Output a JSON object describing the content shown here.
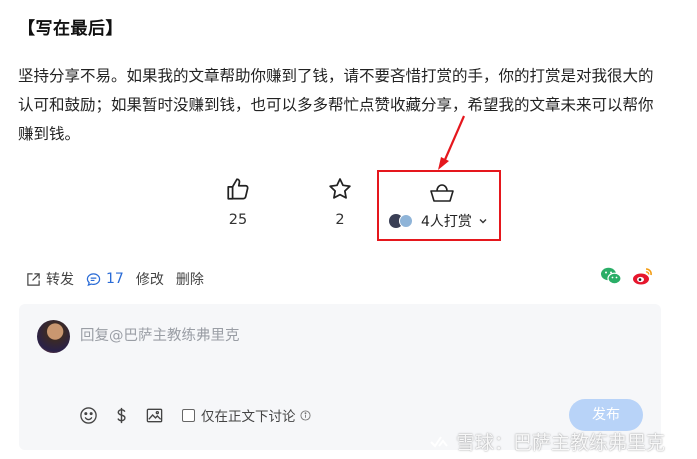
{
  "article": {
    "heading": "【写在最后】",
    "paragraph": "坚持分享不易。如果我的文章帮助你赚到了钱，请不要吝惜打赏的手，你的打赏是对我很大的认可和鼓励；如果暂时没赚到钱，也可以多多帮忙点赞收藏分享，希望我的文章未来可以帮你赚到钱。"
  },
  "actions": {
    "like_count": "25",
    "favorite_count": "2",
    "reward_label": "4人打赏"
  },
  "meta": {
    "repost_label": "转发",
    "comment_count": "17",
    "edit_label": "修改",
    "delete_label": "删除"
  },
  "reply": {
    "placeholder": "回复@巴萨主教练弗里克",
    "checkbox_label": "仅在正文下讨论",
    "publish_label": "发布"
  },
  "watermark": {
    "text": "雪球：巴萨主教练弗里克"
  },
  "colors": {
    "highlight_red": "#e5171d",
    "link_blue": "#2a6bd6",
    "publish_disabled": "#b8d3f8",
    "wechat_green": "#2aae67",
    "weibo_red": "#e6162d"
  }
}
